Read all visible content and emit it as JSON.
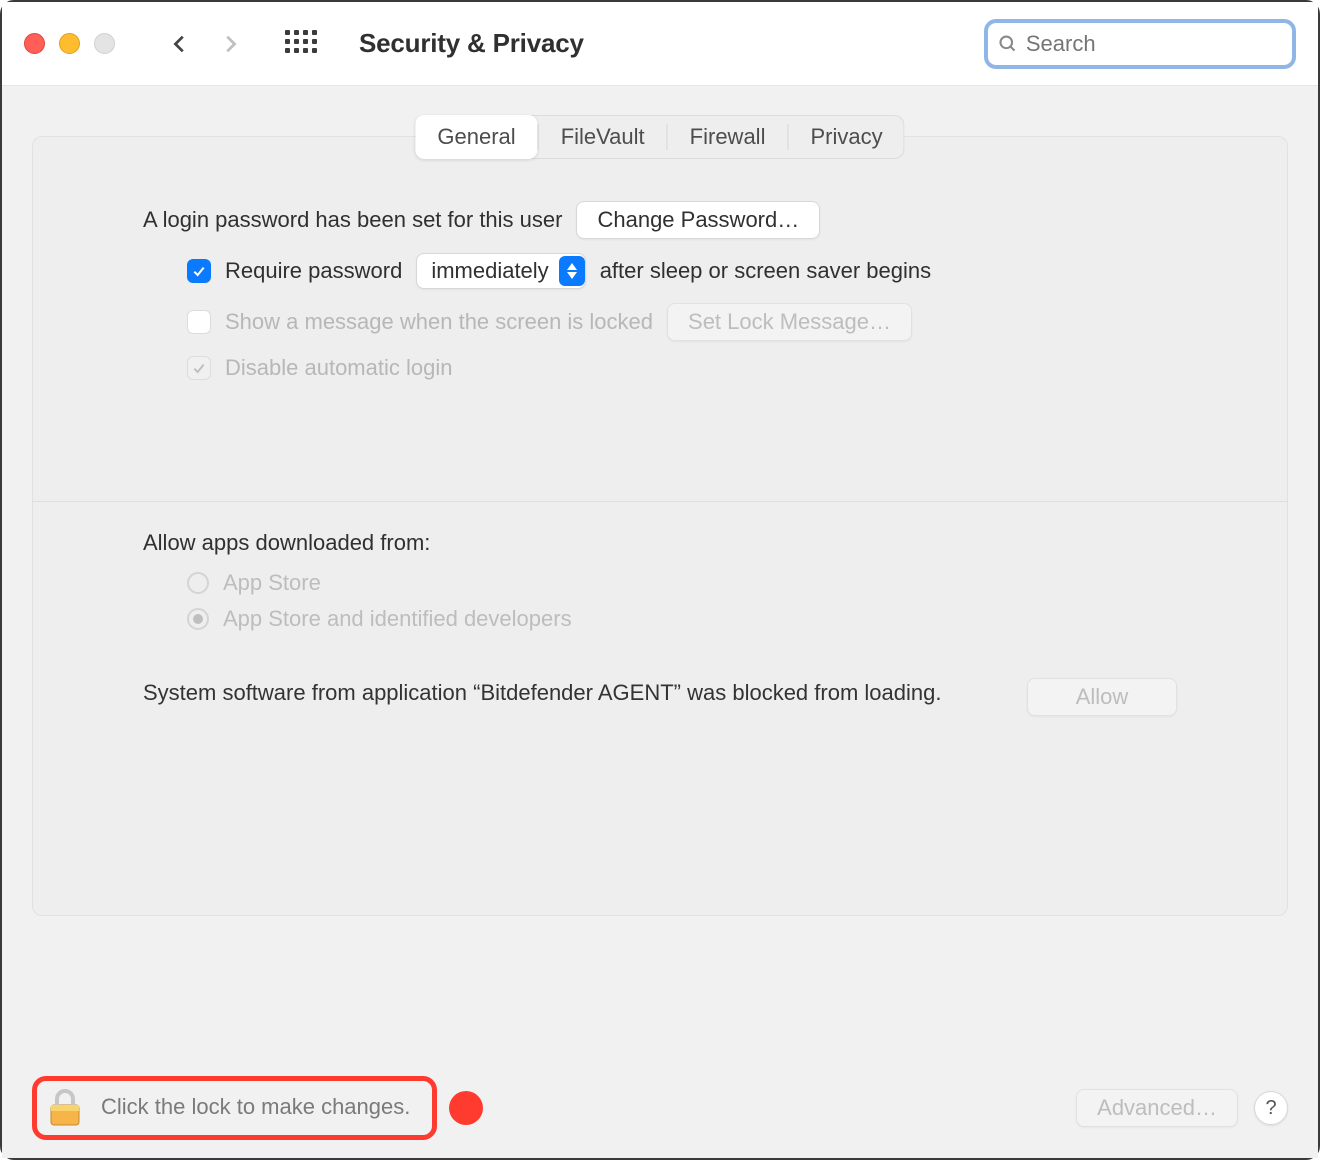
{
  "window": {
    "title": "Security & Privacy"
  },
  "search": {
    "placeholder": "Search",
    "value": ""
  },
  "tabs": [
    {
      "label": "General"
    },
    {
      "label": "FileVault"
    },
    {
      "label": "Firewall"
    },
    {
      "label": "Privacy"
    }
  ],
  "general": {
    "login_password_set": "A login password has been set for this user",
    "change_password_btn": "Change Password…",
    "require_password_label_pre": "Require password",
    "require_password_value": "immediately",
    "require_password_label_post": "after sleep or screen saver begins",
    "show_message_label": "Show a message when the screen is locked",
    "set_lock_message_btn": "Set Lock Message…",
    "disable_auto_login_label": "Disable automatic login"
  },
  "gatekeeper": {
    "heading": "Allow apps downloaded from:",
    "options": [
      {
        "label": "App Store"
      },
      {
        "label": "App Store and identified developers"
      }
    ],
    "blocked_message": "System software from application “Bitdefender AGENT” was blocked from loading.",
    "allow_btn": "Allow"
  },
  "footer": {
    "lock_text": "Click the lock to make changes.",
    "advanced_btn": "Advanced…",
    "help_btn": "?"
  }
}
